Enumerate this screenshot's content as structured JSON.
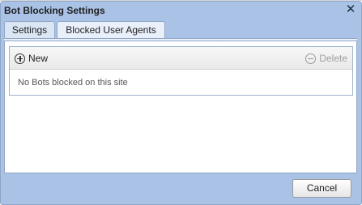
{
  "dialog": {
    "title": "Bot Blocking Settings",
    "close_icon": "close-icon"
  },
  "tabs": [
    {
      "label": "Settings",
      "selected": false
    },
    {
      "label": "Blocked User Agents",
      "selected": true
    }
  ],
  "grid": {
    "toolbar": {
      "new_label": "New",
      "new_icon": "plus-circle-icon",
      "delete_label": "Delete",
      "delete_icon": "minus-circle-icon",
      "delete_enabled": false
    },
    "empty_message": "No Bots blocked on this site"
  },
  "footer": {
    "cancel_label": "Cancel"
  },
  "colors": {
    "dialog_frame": "#a9c2e6",
    "tab_border": "#8fa6c6",
    "disabled_text": "#a0a0a0"
  }
}
